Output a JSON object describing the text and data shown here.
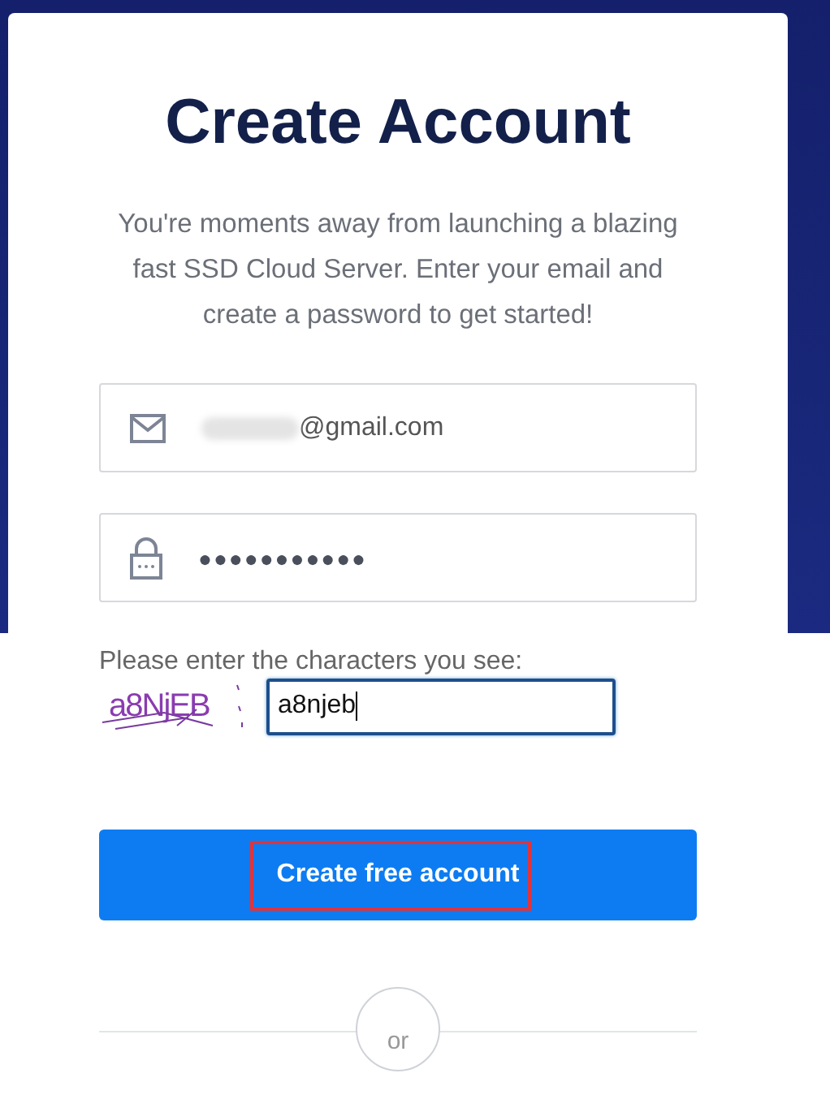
{
  "title": "Create Account",
  "intro": "You're moments away from launching a blazing fast SSD Cloud Server. Enter your email and create a password to get started!",
  "email": {
    "value": "@gmail.com",
    "redacted": true
  },
  "password": {
    "value": "●●●●●●●●●●●"
  },
  "captcha": {
    "label": "Please enter the characters you see:",
    "code": "a8NjEB",
    "value": "a8njeb",
    "focused": true
  },
  "submit": {
    "label": "Create free account",
    "highlighted": true
  },
  "divider": {
    "label": "or"
  }
}
